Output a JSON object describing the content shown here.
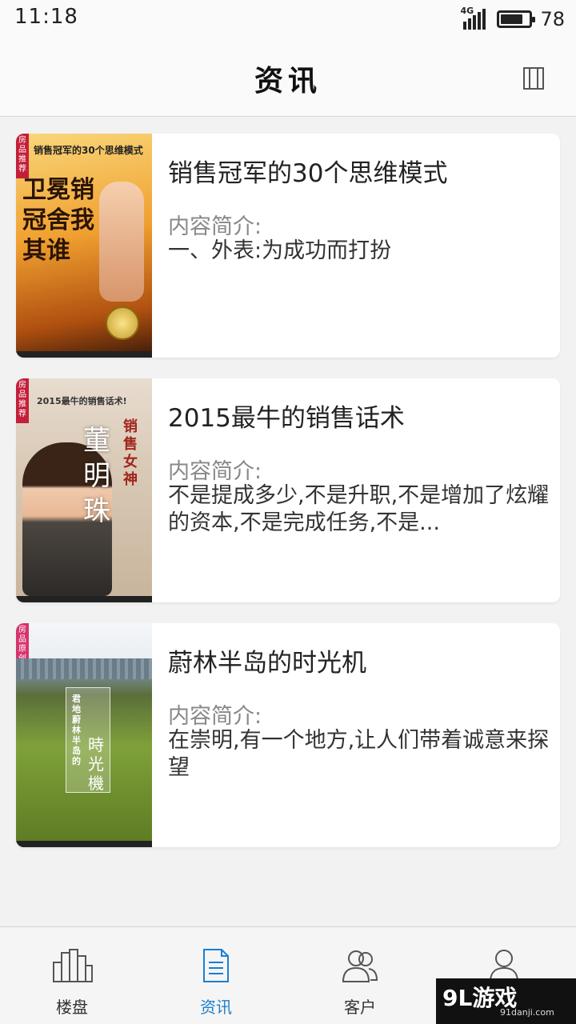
{
  "status": {
    "time": "11:18",
    "network": "4G",
    "battery": "78",
    "battery_level": 0.78
  },
  "header": {
    "title": "资讯",
    "menu_icon": "book-icon"
  },
  "articles": [
    {
      "title": "销售冠军的30个思维模式",
      "intro_label": "内容简介:",
      "summary": "一、外表:为成功而打扮",
      "cover": {
        "tag": "房品推荐",
        "top_text": "销售冠军的30个思维模式",
        "big_text": "卫冕销冠舍我其谁"
      }
    },
    {
      "title": "2015最牛的销售话术",
      "intro_label": "内容简介:",
      "summary": "不是提成多少,不是升职,不是增加了炫耀的资本,不是完成任务,不是...",
      "cover": {
        "tag": "房品推荐",
        "top_text": "2015最牛的销售话术!",
        "side_text": "销售女神",
        "name_text": "董明珠"
      }
    },
    {
      "title": "蔚林半岛的时光机",
      "intro_label": "内容简介:",
      "summary": "在崇明,有一个地方,让人们带着诚意来探望",
      "cover": {
        "tag": "房品原创",
        "plaque_text": "君地蔚林半岛的",
        "big_text": "時光機"
      }
    }
  ],
  "tabs": [
    {
      "label": "楼盘",
      "icon": "buildings-icon",
      "active": false
    },
    {
      "label": "资讯",
      "icon": "document-icon",
      "active": true
    },
    {
      "label": "客户",
      "icon": "customers-icon",
      "active": false
    },
    {
      "label": "",
      "icon": "profile-icon",
      "active": false
    }
  ],
  "watermark": {
    "text": "9L游戏",
    "site": "91danji.com"
  },
  "colors": {
    "accent": "#1a7fd0",
    "background": "#f2f2f2"
  }
}
